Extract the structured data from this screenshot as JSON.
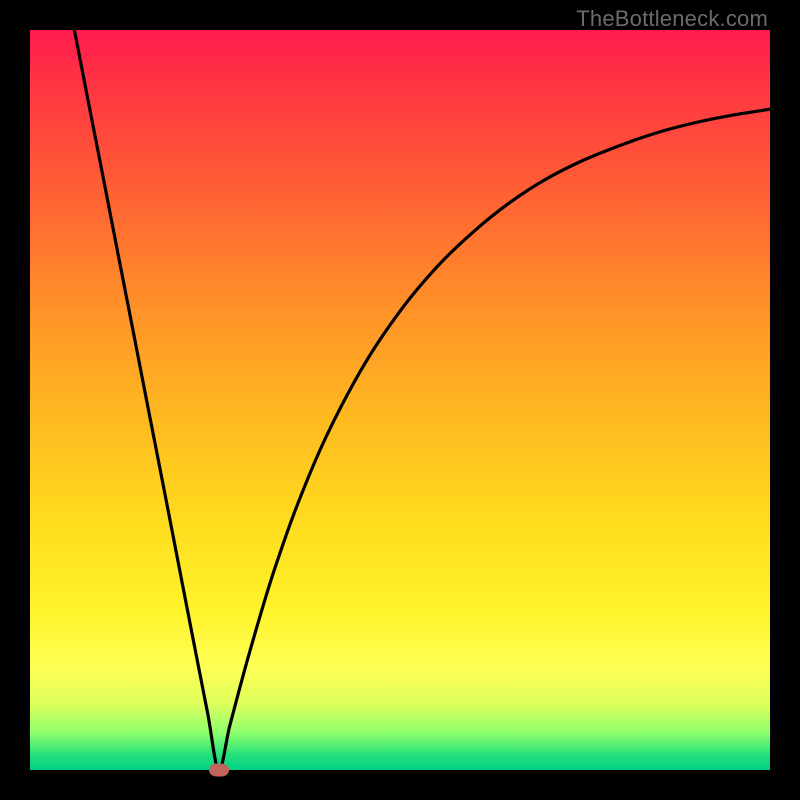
{
  "watermark": "TheBottleneck.com",
  "chart_data": {
    "type": "line",
    "title": "",
    "xlabel": "",
    "ylabel": "",
    "xlim": [
      0,
      1
    ],
    "ylim": [
      0,
      1
    ],
    "series": [
      {
        "name": "curve",
        "x": [
          0.06,
          0.08,
          0.1,
          0.12,
          0.14,
          0.16,
          0.18,
          0.2,
          0.22,
          0.24,
          0.255,
          0.27,
          0.29,
          0.31,
          0.33,
          0.36,
          0.4,
          0.45,
          0.5,
          0.55,
          0.6,
          0.65,
          0.7,
          0.75,
          0.8,
          0.85,
          0.9,
          0.95,
          1.0
        ],
        "y": [
          1.0,
          0.897,
          0.795,
          0.692,
          0.59,
          0.487,
          0.385,
          0.282,
          0.179,
          0.077,
          0.0,
          0.06,
          0.135,
          0.205,
          0.27,
          0.355,
          0.45,
          0.545,
          0.62,
          0.68,
          0.728,
          0.768,
          0.8,
          0.825,
          0.845,
          0.862,
          0.875,
          0.885,
          0.893
        ]
      }
    ],
    "marker": {
      "x": 0.255,
      "y": 0.0
    },
    "background_gradient": {
      "stops": [
        {
          "pos": 0.0,
          "color": "#ff1a4f"
        },
        {
          "pos": 0.5,
          "color": "#ffb321"
        },
        {
          "pos": 0.86,
          "color": "#ffff55"
        },
        {
          "pos": 1.0,
          "color": "#00cf86"
        }
      ]
    }
  }
}
